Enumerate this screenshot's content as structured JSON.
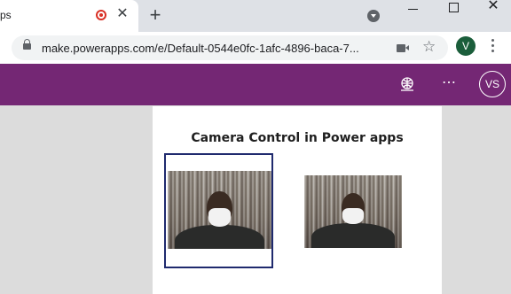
{
  "browser": {
    "tab_title": "ps",
    "tab_close": "✕",
    "new_tab": "+",
    "url": "make.powerapps.com/e/Default-0544e0fc-1afc-4896-baca-7...",
    "profile_initial": "V",
    "window_close": "✕",
    "star": "☆"
  },
  "app": {
    "more": "⋯",
    "user_initials": "VS"
  },
  "screen": {
    "title": "Camera Control in Power apps"
  },
  "colors": {
    "header": "#742774",
    "camera_border": "#1f2a6e",
    "record": "#d93025",
    "profile": "#1b5e3b"
  },
  "icons": [
    "lock-icon",
    "camera-icon",
    "star-icon",
    "more-icon",
    "recording-icon",
    "app-diagnostics-icon"
  ]
}
